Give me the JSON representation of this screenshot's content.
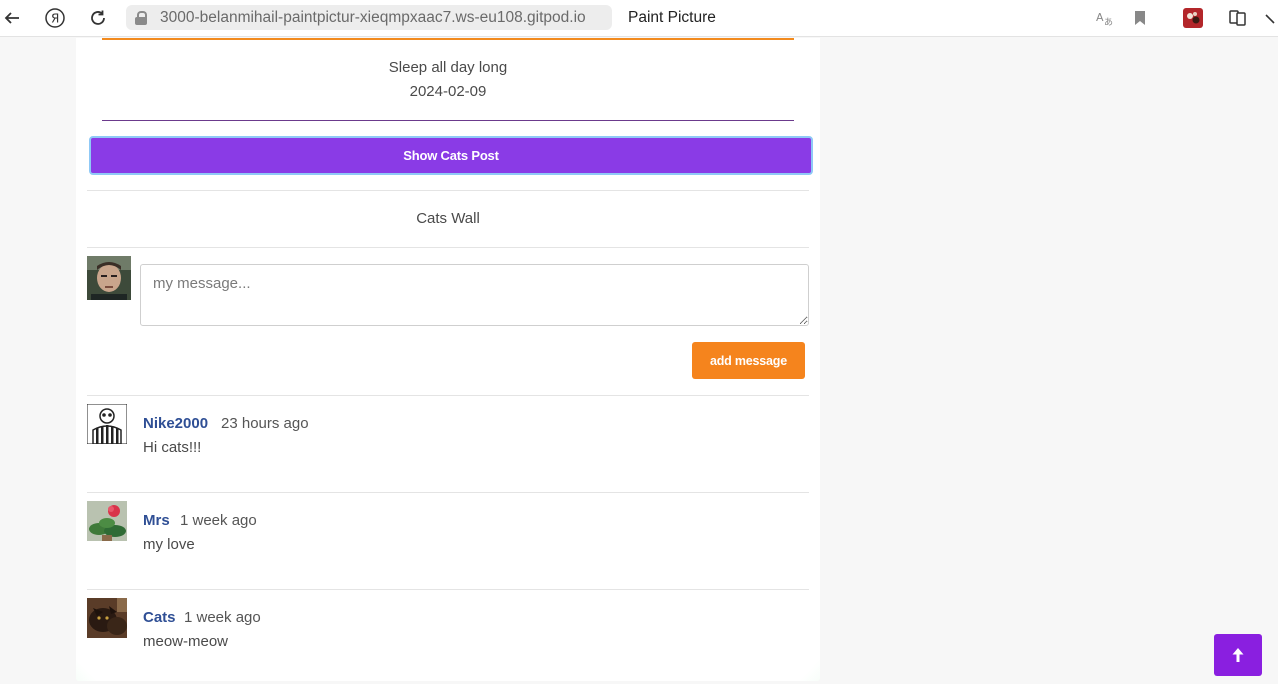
{
  "browser": {
    "url": "3000-belanmihail-paintpictur-xieqmpxaac7.ws-eu108.gitpod.io",
    "tab_title": "Paint Picture",
    "icons": [
      "back-arrow-icon",
      "yandex-logo-icon",
      "reload-icon",
      "lock-icon",
      "translate-icon",
      "bookmark-icon",
      "extension-icon",
      "collections-icon",
      "more-icon"
    ]
  },
  "post": {
    "text": "Sleep all day long",
    "date": "2024-02-09"
  },
  "show_button_label": "Show Cats Post",
  "wall": {
    "title": "Cats Wall",
    "input_placeholder": "my message...",
    "add_button_label": "add message"
  },
  "comments": [
    {
      "name": "Nike2000",
      "time": "23 hours ago",
      "text": "Hi cats!!!"
    },
    {
      "name": "Mrs",
      "time": "1 week ago",
      "text": "my love"
    },
    {
      "name": "Cats",
      "time": "1 week ago",
      "text": "meow-meow"
    }
  ],
  "scroll_top_icon": "arrow-up-icon",
  "colors": {
    "accent_purple": "#8a3be6",
    "accent_orange": "#f5841d",
    "username_blue": "#2f4f95",
    "scroll_button": "#8a1fe0"
  }
}
